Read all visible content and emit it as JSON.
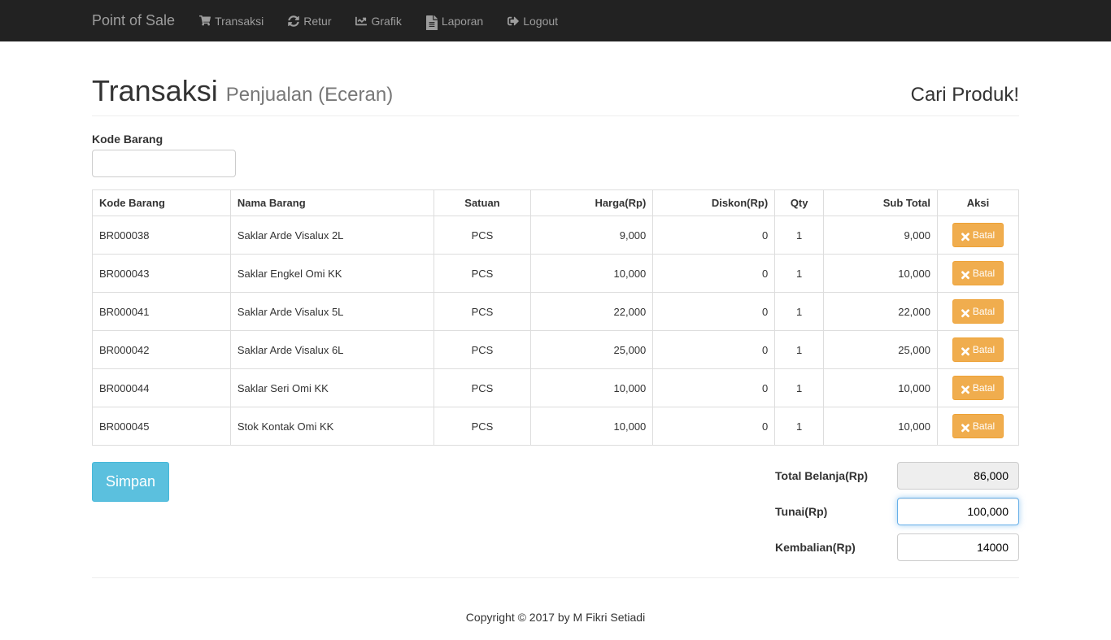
{
  "navbar": {
    "brand": "Point of Sale",
    "items": [
      {
        "label": "Transaksi"
      },
      {
        "label": "Retur"
      },
      {
        "label": "Grafik"
      },
      {
        "label": "Laporan"
      },
      {
        "label": "Logout"
      }
    ]
  },
  "header": {
    "title": "Transaksi",
    "subtitle": "Penjualan (Eceran)",
    "cariProduk": "Cari Produk!"
  },
  "form": {
    "kodeBarangLabel": "Kode Barang"
  },
  "table": {
    "headers": {
      "kode": "Kode Barang",
      "nama": "Nama Barang",
      "satuan": "Satuan",
      "harga": "Harga(Rp)",
      "diskon": "Diskon(Rp)",
      "qty": "Qty",
      "subtotal": "Sub Total",
      "aksi": "Aksi"
    },
    "rows": [
      {
        "kode": "BR000038",
        "nama": "Saklar Arde Visalux 2L",
        "satuan": "PCS",
        "harga": "9,000",
        "diskon": "0",
        "qty": "1",
        "subtotal": "9,000"
      },
      {
        "kode": "BR000043",
        "nama": "Saklar Engkel Omi KK",
        "satuan": "PCS",
        "harga": "10,000",
        "diskon": "0",
        "qty": "1",
        "subtotal": "10,000"
      },
      {
        "kode": "BR000041",
        "nama": "Saklar Arde Visalux 5L",
        "satuan": "PCS",
        "harga": "22,000",
        "diskon": "0",
        "qty": "1",
        "subtotal": "22,000"
      },
      {
        "kode": "BR000042",
        "nama": "Saklar Arde Visalux 6L",
        "satuan": "PCS",
        "harga": "25,000",
        "diskon": "0",
        "qty": "1",
        "subtotal": "25,000"
      },
      {
        "kode": "BR000044",
        "nama": "Saklar Seri Omi KK",
        "satuan": "PCS",
        "harga": "10,000",
        "diskon": "0",
        "qty": "1",
        "subtotal": "10,000"
      },
      {
        "kode": "BR000045",
        "nama": "Stok Kontak Omi KK",
        "satuan": "PCS",
        "harga": "10,000",
        "diskon": "0",
        "qty": "1",
        "subtotal": "10,000"
      }
    ],
    "batalLabel": "Batal"
  },
  "totals": {
    "totalBelanjaLabel": "Total Belanja(Rp)",
    "totalBelanja": "86,000",
    "tunaiLabel": "Tunai(Rp)",
    "tunai": "100,000",
    "kembalianLabel": "Kembalian(Rp)",
    "kembalian": "14000",
    "simpanLabel": "Simpan"
  },
  "footer": "Copyright © 2017 by M Fikri Setiadi"
}
